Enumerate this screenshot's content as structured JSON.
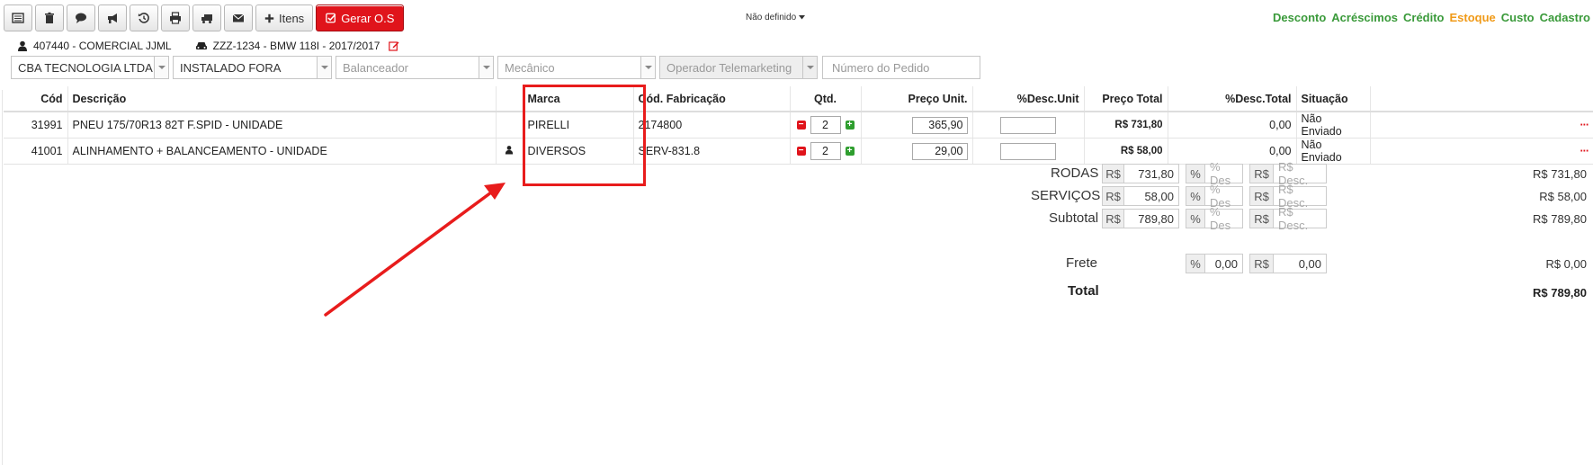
{
  "toolbar": {
    "items_label": "Itens",
    "gerar_label": "Gerar O.S"
  },
  "status": {
    "label": "Não definido"
  },
  "top_links": [
    {
      "label": "Desconto",
      "color": "#3a9a3a"
    },
    {
      "label": "Acréscimos",
      "color": "#3a9a3a"
    },
    {
      "label": "Crédito",
      "color": "#3a9a3a"
    },
    {
      "label": "Estoque",
      "color": "#f09a18"
    },
    {
      "label": "Custo",
      "color": "#3a9a3a"
    },
    {
      "label": "Cadastro",
      "color": "#3a9a3a"
    }
  ],
  "customer": {
    "label": "407440 - COMERCIAL JJML"
  },
  "vehicle": {
    "label": "ZZZ-1234 - BMW 118I - 2017/2017"
  },
  "selects": {
    "company": "CBA TECNOLOGIA LTDA",
    "install": "INSTALADO FORA",
    "balancer": "Balanceador",
    "mechanic": "Mecânico",
    "telemarketing": "Operador Telemarketing",
    "order_placeholder": "Número do Pedido"
  },
  "table": {
    "headers": [
      "Cód",
      "Descrição",
      "Marca",
      "Cód. Fabricação",
      "Qtd.",
      "Preço Unit.",
      "%Desc.Unit",
      "Preço Total",
      "%Desc.Total",
      "Situação"
    ],
    "rows": [
      {
        "code": "31991",
        "description": "PNEU 175/70R13 82T F.SPID - UNIDADE",
        "brand": "PIRELLI",
        "mfr_code": "2174800",
        "qty": "2",
        "unit_price": "365,90",
        "total": "R$ 731,80",
        "desc_total": "0,00",
        "status": "Não Enviado"
      },
      {
        "code": "41001",
        "description": "ALINHAMENTO + BALANCEAMENTO - UNIDADE",
        "brand": "DIVERSOS",
        "mfr_code": "SERV-831.8",
        "qty": "2",
        "unit_price": "29,00",
        "total": "R$ 58,00",
        "desc_total": "0,00",
        "status": "Não Enviado"
      }
    ]
  },
  "summary": {
    "currency": "R$",
    "percent": "%",
    "pct_placeholder": "% Des",
    "rs_placeholder": "R$ Desc.",
    "rodas": {
      "label": "RODAS",
      "value": "731,80",
      "total": "R$ 731,80"
    },
    "servicos": {
      "label": "SERVIÇOS",
      "value": "58,00",
      "total": "R$ 58,00"
    },
    "subtotal": {
      "label": "Subtotal",
      "value": "789,80",
      "total": "R$ 789,80"
    },
    "frete": {
      "label": "Frete",
      "pct": "0,00",
      "rs": "0,00",
      "total": "R$ 0,00"
    },
    "grand_total": {
      "label": "Total",
      "value": "R$ 789,80"
    }
  },
  "annotation": {
    "color": "#e81c1c"
  }
}
